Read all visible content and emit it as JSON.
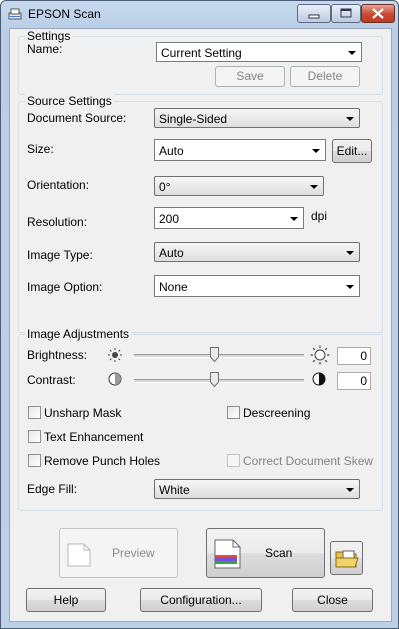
{
  "window": {
    "title": "EPSON Scan"
  },
  "settings": {
    "group_title": "Settings",
    "name_label": "Name:",
    "name_value": "Current Setting",
    "save_label": "Save",
    "delete_label": "Delete"
  },
  "source": {
    "group_title": "Source Settings",
    "doc_source_label": "Document Source:",
    "doc_source_value": "Single-Sided",
    "size_label": "Size:",
    "size_value": "Auto",
    "edit_label": "Edit...",
    "orientation_label": "Orientation:",
    "orientation_value": "0°",
    "resolution_label": "Resolution:",
    "resolution_value": "200",
    "dpi_label": "dpi",
    "image_type_label": "Image Type:",
    "image_type_value": "Auto",
    "image_option_label": "Image Option:",
    "image_option_value": "None"
  },
  "adjust": {
    "group_title": "Image Adjustments",
    "brightness_label": "Brightness:",
    "brightness_value": "0",
    "contrast_label": "Contrast:",
    "contrast_value": "0",
    "unsharp_label": "Unsharp Mask",
    "descreen_label": "Descreening",
    "text_enh_label": "Text Enhancement",
    "punch_label": "Remove Punch Holes",
    "skew_label": "Correct Document Skew",
    "edge_fill_label": "Edge Fill:",
    "edge_fill_value": "White"
  },
  "actions": {
    "preview_label": "Preview",
    "scan_label": "Scan",
    "help_label": "Help",
    "config_label": "Configuration...",
    "close_label": "Close"
  },
  "colors": {
    "accent": "#c2391f",
    "title_gradient_top": "#c5d9ee"
  }
}
